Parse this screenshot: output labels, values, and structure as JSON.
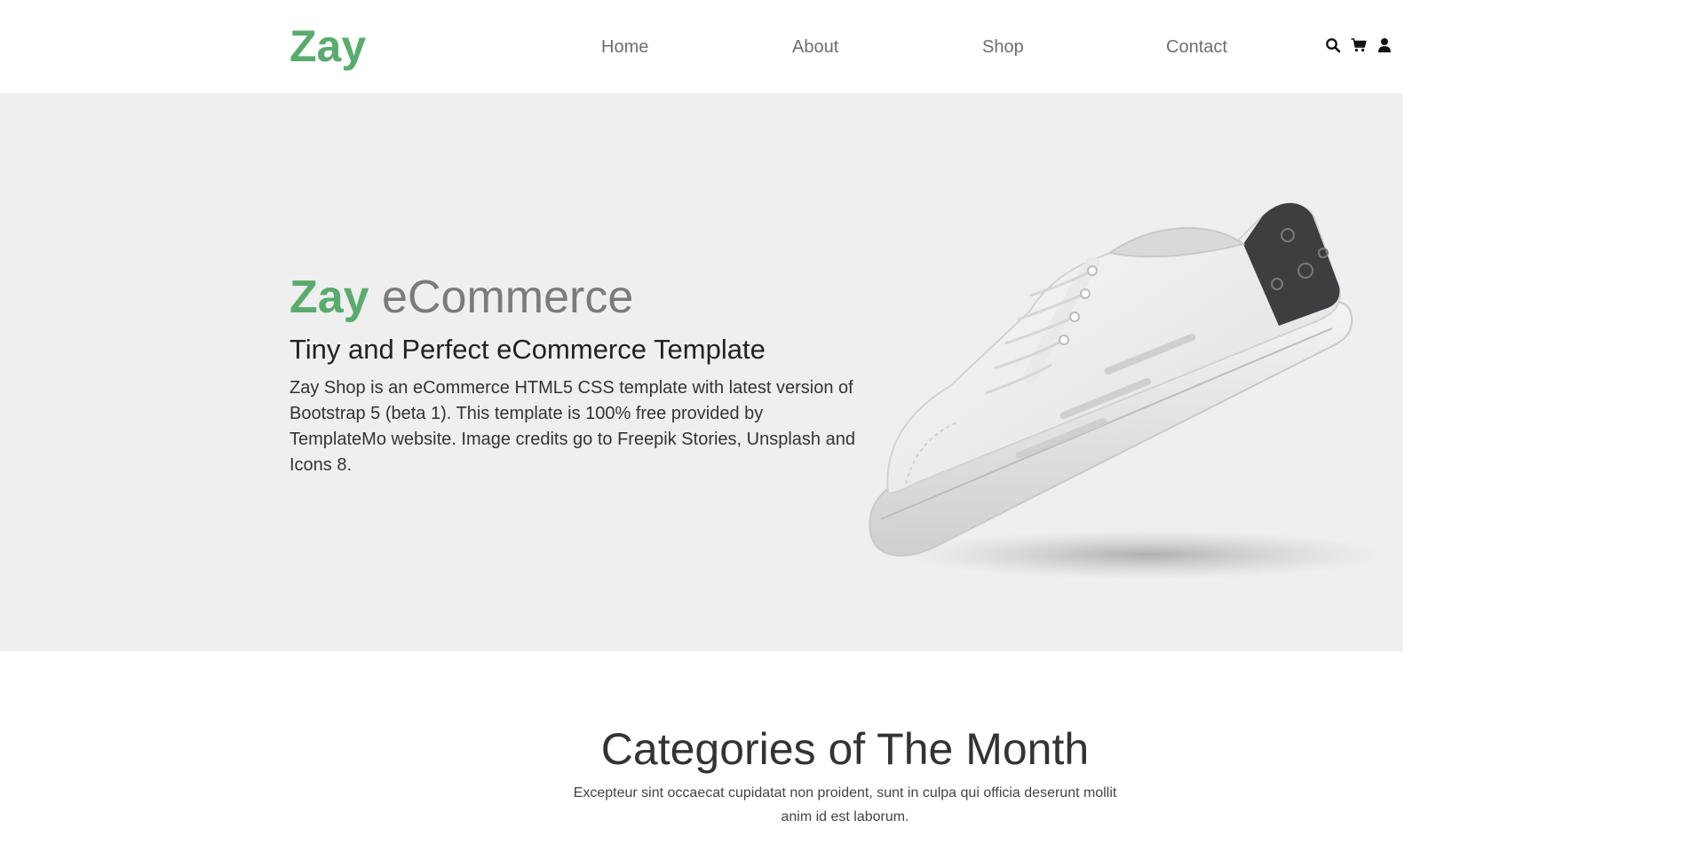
{
  "header": {
    "brand": "Zay",
    "nav": {
      "home": "Home",
      "about": "About",
      "shop": "Shop",
      "contact": "Contact"
    },
    "icons": [
      "search-icon",
      "cart-icon",
      "user-icon"
    ]
  },
  "hero": {
    "title_accent": "Zay",
    "title_rest": " eCommerce",
    "subtitle": "Tiny and Perfect eCommerce Template",
    "description": "Zay Shop is an eCommerce HTML5 CSS template with latest version of Bootstrap 5 (beta 1). This template is 100% free provided by TemplateMo website. Image credits go to Freepik Stories, Unsplash and Icons 8.",
    "image": "sneaker-image"
  },
  "categories": {
    "title": "Categories of The Month",
    "description": "Excepteur sint occaecat cupidatat non proident, sunt in culpa qui officia deserunt mollit anim id est laborum."
  },
  "colors": {
    "accent": "#59ab6e",
    "hero_bg": "#efefef",
    "nav_text": "#6e6e6e"
  }
}
